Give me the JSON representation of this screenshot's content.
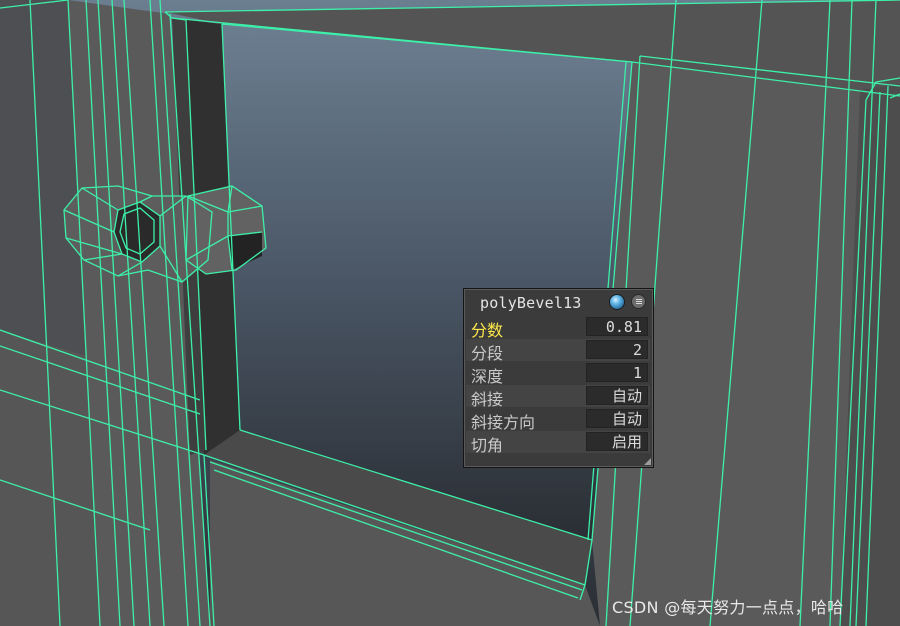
{
  "hud": {
    "title": "polyBevel13",
    "attributes": [
      {
        "label": "分数",
        "value": "0.81",
        "active": true
      },
      {
        "label": "分段",
        "value": "2",
        "active": false
      },
      {
        "label": "深度",
        "value": "1",
        "active": false
      },
      {
        "label": "斜接",
        "value": "自动",
        "active": false
      },
      {
        "label": "斜接方向",
        "value": "自动",
        "active": false
      },
      {
        "label": "切角",
        "value": "启用",
        "active": false
      }
    ],
    "icons": {
      "sphere": "material-sphere-icon",
      "menu": "menu-icon",
      "grip": "resize-grip-icon"
    }
  },
  "watermark": "CSDN @每天努力一点点，哈哈",
  "colors": {
    "wireframe": "#3df0a9",
    "active_label": "#ffe84a",
    "sky_top": "#677a8c",
    "sky_bottom": "#2a2d33"
  }
}
